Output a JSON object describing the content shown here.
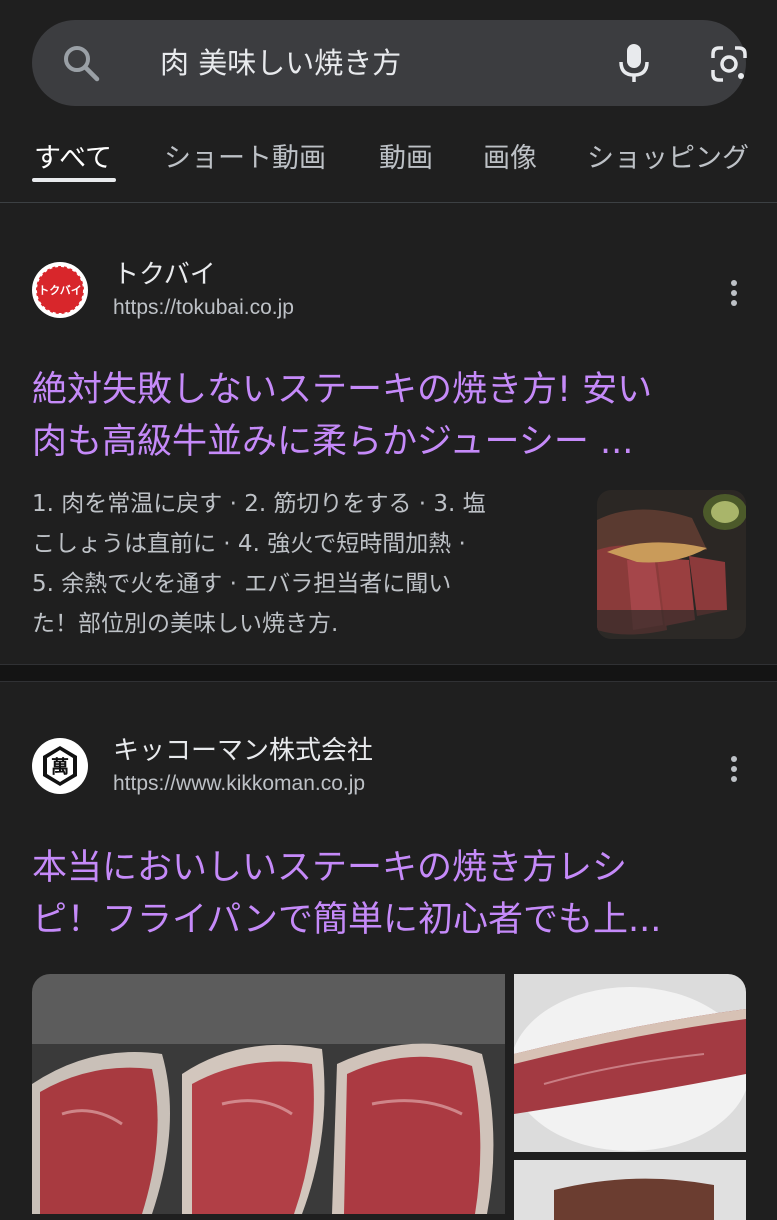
{
  "search": {
    "query": "肉 美味しい焼き方",
    "icons": [
      "search-icon",
      "microphone-icon",
      "google-lens-icon"
    ]
  },
  "tabs": [
    {
      "label": "すべて",
      "active": true
    },
    {
      "label": "ショート動画",
      "active": false
    },
    {
      "label": "動画",
      "active": false
    },
    {
      "label": "画像",
      "active": false
    },
    {
      "label": "ショッピング",
      "active": false
    }
  ],
  "results": [
    {
      "site_name": "トクバイ",
      "url": "https://tokubai.co.jp",
      "favicon_text": "トクバイ",
      "title_lines": [
        "絶対失敗しないステーキの焼き方! 安い",
        "肉も高級牛並みに柔らかジューシー ..."
      ],
      "snippet_lines": [
        "1. 肉を常温に戻す · 2. 筋切りをする · 3. 塩",
        "こしょうは直前に · 4. 強火で短時間加熱 ·",
        "5. 余熱で火を通す · エバラ担当者に聞い",
        "た！部位別の美味しい焼き方."
      ]
    },
    {
      "site_name": "キッコーマン株式会社",
      "url": "https://www.kikkoman.co.jp",
      "favicon_text": "萬",
      "title_lines": [
        "本当においしいステーキの焼き方レシ",
        "ピ！フライパンで簡単に初心者でも上..."
      ]
    }
  ],
  "colors": {
    "background": "#1f1f1f",
    "search_bar": "#3c3d40",
    "link_visited": "#c58af9",
    "text_primary": "#e8eaed",
    "text_secondary": "#bdc1c6"
  }
}
